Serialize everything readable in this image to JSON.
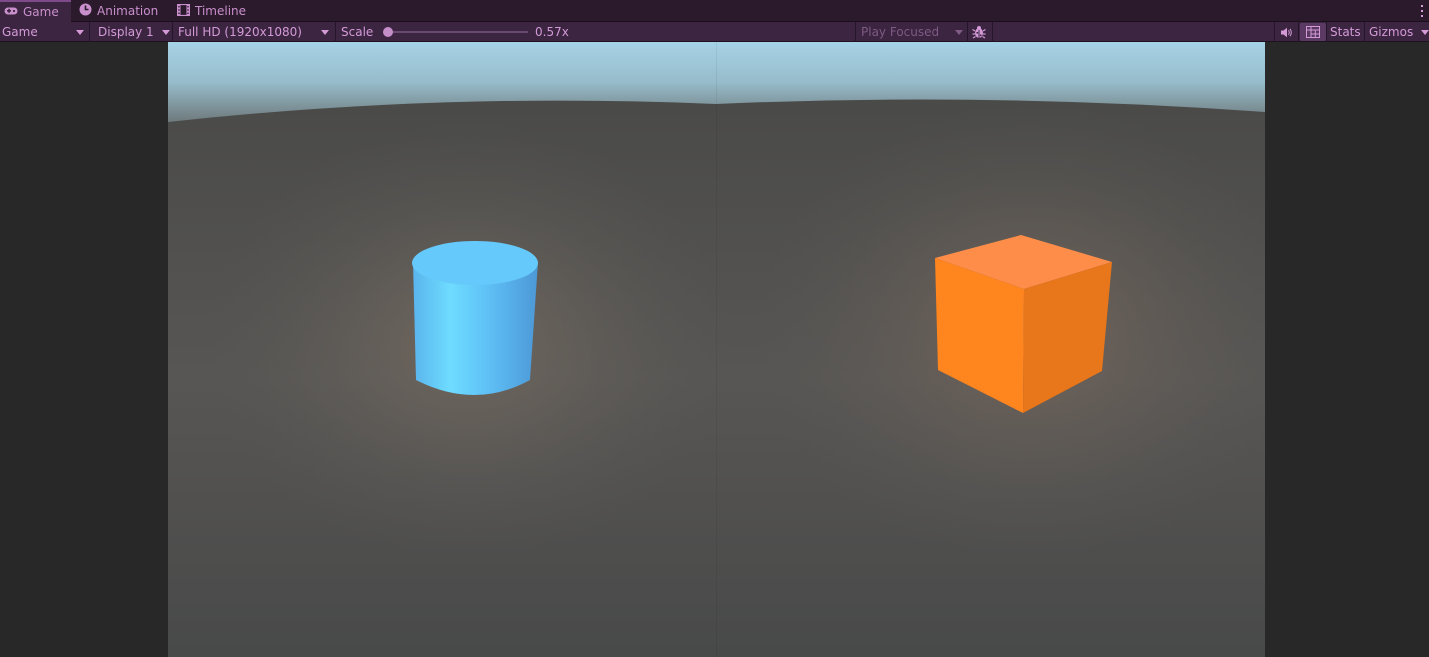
{
  "tabs": [
    {
      "label": "Game",
      "icon": "gamepad-icon",
      "active": true
    },
    {
      "label": "Animation",
      "icon": "animation-clock-icon",
      "active": false
    },
    {
      "label": "Timeline",
      "icon": "film-strip-icon",
      "active": false
    }
  ],
  "toolbar": {
    "mode_dropdown": "Game",
    "display_dropdown": "Display 1",
    "resolution_dropdown": "Full HD (1920x1080)",
    "scale_label": "Scale",
    "scale_value": "0.57x",
    "scale_level": 0.02,
    "play_mode_dropdown": "Play Focused",
    "stats_label": "Stats",
    "gizmos_label": "Gizmos",
    "icons": [
      "bug-icon",
      "speaker-icon",
      "grid-toggle-icon",
      "kebab-menu-icon"
    ]
  },
  "scene": {
    "objects": [
      {
        "name": "cylinder",
        "color": "#5cc8ff"
      },
      {
        "name": "cube",
        "color": "#ff8a1e"
      }
    ],
    "sky_color": "#a6d3e6",
    "ground_color": "#545454"
  },
  "colors": {
    "tab_bar": "#2a1a2c",
    "toolbar": "#3b2540",
    "accent_text": "#d49ad8",
    "editor_bg": "#282828"
  }
}
